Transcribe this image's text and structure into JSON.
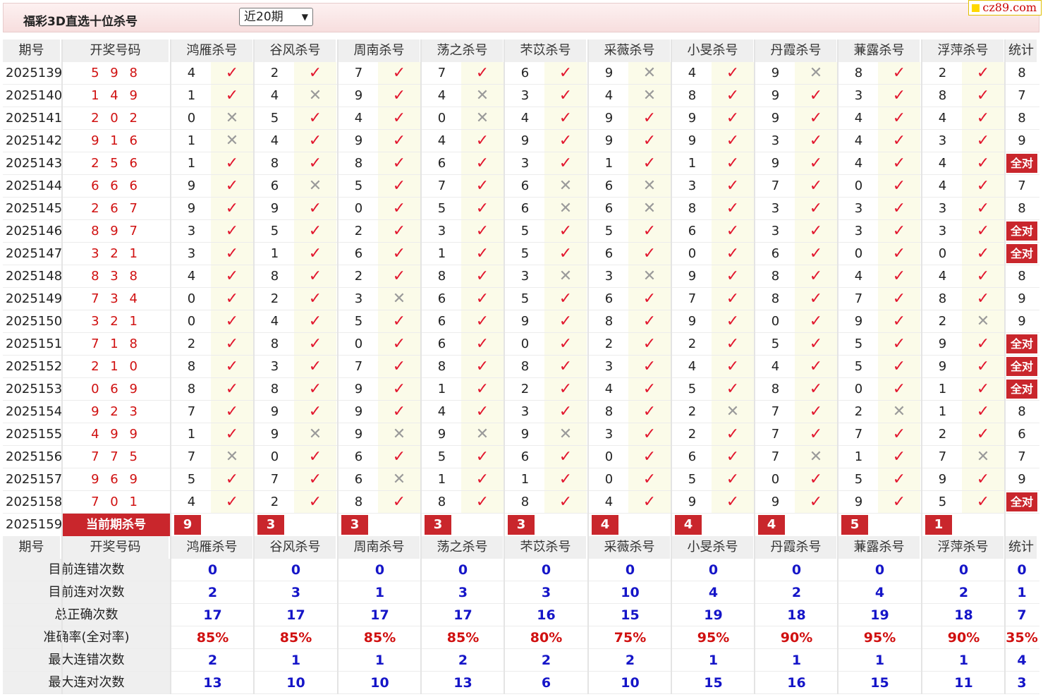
{
  "header": {
    "title": "福彩3D直选十位杀号",
    "period_select": "近20期",
    "logo": "cz89.com"
  },
  "columns": {
    "issue": "期号",
    "draw": "开奖号码",
    "experts": [
      "鸿雁杀号",
      "谷风杀号",
      "周南杀号",
      "荡之杀号",
      "芣苡杀号",
      "采薇杀号",
      "小旻杀号",
      "丹霞杀号",
      "蒹露杀号",
      "浮萍杀号"
    ],
    "stat": "统计"
  },
  "rows": [
    {
      "issue": "2025139",
      "draw": "5 9 8",
      "kills": [
        [
          4,
          1
        ],
        [
          2,
          1
        ],
        [
          7,
          1
        ],
        [
          7,
          1
        ],
        [
          6,
          1
        ],
        [
          9,
          0
        ],
        [
          4,
          1
        ],
        [
          9,
          0
        ],
        [
          8,
          1
        ],
        [
          2,
          1
        ]
      ],
      "stat": "8"
    },
    {
      "issue": "2025140",
      "draw": "1 4 9",
      "kills": [
        [
          1,
          1
        ],
        [
          4,
          0
        ],
        [
          9,
          1
        ],
        [
          4,
          0
        ],
        [
          3,
          1
        ],
        [
          4,
          0
        ],
        [
          8,
          1
        ],
        [
          9,
          1
        ],
        [
          3,
          1
        ],
        [
          8,
          1
        ]
      ],
      "stat": "7"
    },
    {
      "issue": "2025141",
      "draw": "2 0 2",
      "kills": [
        [
          0,
          0
        ],
        [
          5,
          1
        ],
        [
          4,
          1
        ],
        [
          0,
          0
        ],
        [
          4,
          1
        ],
        [
          9,
          1
        ],
        [
          9,
          1
        ],
        [
          9,
          1
        ],
        [
          4,
          1
        ],
        [
          4,
          1
        ]
      ],
      "stat": "8"
    },
    {
      "issue": "2025142",
      "draw": "9 1 6",
      "kills": [
        [
          1,
          0
        ],
        [
          4,
          1
        ],
        [
          9,
          1
        ],
        [
          4,
          1
        ],
        [
          9,
          1
        ],
        [
          9,
          1
        ],
        [
          9,
          1
        ],
        [
          3,
          1
        ],
        [
          4,
          1
        ],
        [
          3,
          1
        ]
      ],
      "stat": "9"
    },
    {
      "issue": "2025143",
      "draw": "2 5 6",
      "kills": [
        [
          1,
          1
        ],
        [
          8,
          1
        ],
        [
          8,
          1
        ],
        [
          6,
          1
        ],
        [
          3,
          1
        ],
        [
          1,
          1
        ],
        [
          1,
          1
        ],
        [
          9,
          1
        ],
        [
          4,
          1
        ],
        [
          4,
          1
        ]
      ],
      "stat": "全对"
    },
    {
      "issue": "2025144",
      "draw": "6 6 6",
      "kills": [
        [
          9,
          1
        ],
        [
          6,
          0
        ],
        [
          5,
          1
        ],
        [
          7,
          1
        ],
        [
          6,
          0
        ],
        [
          6,
          0
        ],
        [
          3,
          1
        ],
        [
          7,
          1
        ],
        [
          0,
          1
        ],
        [
          4,
          1
        ]
      ],
      "stat": "7"
    },
    {
      "issue": "2025145",
      "draw": "2 6 7",
      "kills": [
        [
          9,
          1
        ],
        [
          9,
          1
        ],
        [
          0,
          1
        ],
        [
          5,
          1
        ],
        [
          6,
          0
        ],
        [
          6,
          0
        ],
        [
          8,
          1
        ],
        [
          3,
          1
        ],
        [
          3,
          1
        ],
        [
          3,
          1
        ]
      ],
      "stat": "8"
    },
    {
      "issue": "2025146",
      "draw": "8 9 7",
      "kills": [
        [
          3,
          1
        ],
        [
          5,
          1
        ],
        [
          2,
          1
        ],
        [
          3,
          1
        ],
        [
          5,
          1
        ],
        [
          5,
          1
        ],
        [
          6,
          1
        ],
        [
          3,
          1
        ],
        [
          3,
          1
        ],
        [
          3,
          1
        ]
      ],
      "stat": "全对"
    },
    {
      "issue": "2025147",
      "draw": "3 2 1",
      "kills": [
        [
          3,
          1
        ],
        [
          1,
          1
        ],
        [
          6,
          1
        ],
        [
          1,
          1
        ],
        [
          5,
          1
        ],
        [
          6,
          1
        ],
        [
          0,
          1
        ],
        [
          6,
          1
        ],
        [
          0,
          1
        ],
        [
          0,
          1
        ]
      ],
      "stat": "全对"
    },
    {
      "issue": "2025148",
      "draw": "8 3 8",
      "kills": [
        [
          4,
          1
        ],
        [
          8,
          1
        ],
        [
          2,
          1
        ],
        [
          8,
          1
        ],
        [
          3,
          0
        ],
        [
          3,
          0
        ],
        [
          9,
          1
        ],
        [
          8,
          1
        ],
        [
          4,
          1
        ],
        [
          4,
          1
        ]
      ],
      "stat": "8"
    },
    {
      "issue": "2025149",
      "draw": "7 3 4",
      "kills": [
        [
          0,
          1
        ],
        [
          2,
          1
        ],
        [
          3,
          0
        ],
        [
          6,
          1
        ],
        [
          5,
          1
        ],
        [
          6,
          1
        ],
        [
          7,
          1
        ],
        [
          8,
          1
        ],
        [
          7,
          1
        ],
        [
          8,
          1
        ]
      ],
      "stat": "9"
    },
    {
      "issue": "2025150",
      "draw": "3 2 1",
      "kills": [
        [
          0,
          1
        ],
        [
          4,
          1
        ],
        [
          5,
          1
        ],
        [
          6,
          1
        ],
        [
          9,
          1
        ],
        [
          8,
          1
        ],
        [
          9,
          1
        ],
        [
          0,
          1
        ],
        [
          9,
          1
        ],
        [
          2,
          0
        ]
      ],
      "stat": "9"
    },
    {
      "issue": "2025151",
      "draw": "7 1 8",
      "kills": [
        [
          2,
          1
        ],
        [
          8,
          1
        ],
        [
          0,
          1
        ],
        [
          6,
          1
        ],
        [
          0,
          1
        ],
        [
          2,
          1
        ],
        [
          2,
          1
        ],
        [
          5,
          1
        ],
        [
          5,
          1
        ],
        [
          9,
          1
        ]
      ],
      "stat": "全对"
    },
    {
      "issue": "2025152",
      "draw": "2 1 0",
      "kills": [
        [
          8,
          1
        ],
        [
          3,
          1
        ],
        [
          7,
          1
        ],
        [
          8,
          1
        ],
        [
          8,
          1
        ],
        [
          3,
          1
        ],
        [
          4,
          1
        ],
        [
          4,
          1
        ],
        [
          5,
          1
        ],
        [
          9,
          1
        ]
      ],
      "stat": "全对"
    },
    {
      "issue": "2025153",
      "draw": "0 6 9",
      "kills": [
        [
          8,
          1
        ],
        [
          8,
          1
        ],
        [
          9,
          1
        ],
        [
          1,
          1
        ],
        [
          2,
          1
        ],
        [
          4,
          1
        ],
        [
          5,
          1
        ],
        [
          8,
          1
        ],
        [
          0,
          1
        ],
        [
          1,
          1
        ]
      ],
      "stat": "全对"
    },
    {
      "issue": "2025154",
      "draw": "9 2 3",
      "kills": [
        [
          7,
          1
        ],
        [
          9,
          1
        ],
        [
          9,
          1
        ],
        [
          4,
          1
        ],
        [
          3,
          1
        ],
        [
          8,
          1
        ],
        [
          2,
          0
        ],
        [
          7,
          1
        ],
        [
          2,
          0
        ],
        [
          1,
          1
        ]
      ],
      "stat": "8"
    },
    {
      "issue": "2025155",
      "draw": "4 9 9",
      "kills": [
        [
          1,
          1
        ],
        [
          9,
          0
        ],
        [
          9,
          0
        ],
        [
          9,
          0
        ],
        [
          9,
          0
        ],
        [
          3,
          1
        ],
        [
          2,
          1
        ],
        [
          7,
          1
        ],
        [
          7,
          1
        ],
        [
          2,
          1
        ]
      ],
      "stat": "6"
    },
    {
      "issue": "2025156",
      "draw": "7 7 5",
      "kills": [
        [
          7,
          0
        ],
        [
          0,
          1
        ],
        [
          6,
          1
        ],
        [
          5,
          1
        ],
        [
          6,
          1
        ],
        [
          0,
          1
        ],
        [
          6,
          1
        ],
        [
          7,
          0
        ],
        [
          1,
          1
        ],
        [
          7,
          0
        ]
      ],
      "stat": "7"
    },
    {
      "issue": "2025157",
      "draw": "9 6 9",
      "kills": [
        [
          5,
          1
        ],
        [
          7,
          1
        ],
        [
          6,
          0
        ],
        [
          1,
          1
        ],
        [
          1,
          1
        ],
        [
          0,
          1
        ],
        [
          5,
          1
        ],
        [
          0,
          1
        ],
        [
          5,
          1
        ],
        [
          9,
          1
        ]
      ],
      "stat": "9"
    },
    {
      "issue": "2025158",
      "draw": "7 0 1",
      "kills": [
        [
          4,
          1
        ],
        [
          2,
          1
        ],
        [
          8,
          1
        ],
        [
          8,
          1
        ],
        [
          8,
          1
        ],
        [
          4,
          1
        ],
        [
          9,
          1
        ],
        [
          9,
          1
        ],
        [
          9,
          1
        ],
        [
          5,
          1
        ]
      ],
      "stat": "全对"
    }
  ],
  "current": {
    "issue": "2025159",
    "label": "当前期杀号",
    "kills": [
      "9",
      "3",
      "3",
      "3",
      "3",
      "4",
      "4",
      "4",
      "5",
      "1"
    ]
  },
  "stats": [
    {
      "label": "目前连错次数",
      "values": [
        "0",
        "0",
        "0",
        "0",
        "0",
        "0",
        "0",
        "0",
        "0",
        "0"
      ],
      "stat": "0",
      "color": "blue"
    },
    {
      "label": "目前连对次数",
      "values": [
        "2",
        "3",
        "1",
        "3",
        "3",
        "10",
        "4",
        "2",
        "4",
        "2"
      ],
      "stat": "1",
      "color": "blue"
    },
    {
      "label": "总正确次数",
      "values": [
        "17",
        "17",
        "17",
        "17",
        "16",
        "15",
        "19",
        "18",
        "19",
        "18"
      ],
      "stat": "7",
      "color": "blue"
    },
    {
      "label": "准确率(全对率)",
      "values": [
        "85%",
        "85%",
        "85%",
        "85%",
        "80%",
        "75%",
        "95%",
        "90%",
        "95%",
        "90%"
      ],
      "stat": "35%",
      "color": "red"
    },
    {
      "label": "最大连错次数",
      "values": [
        "2",
        "1",
        "1",
        "2",
        "2",
        "2",
        "1",
        "1",
        "1",
        "1"
      ],
      "stat": "4",
      "color": "blue"
    },
    {
      "label": "最大连对次数",
      "values": [
        "13",
        "10",
        "10",
        "13",
        "6",
        "10",
        "15",
        "16",
        "15",
        "11"
      ],
      "stat": "3",
      "color": "blue"
    }
  ],
  "symbols": {
    "tick": "✓",
    "cross": "✕"
  },
  "colors": {
    "accent": "#c9262c",
    "draw": "#d01010",
    "stat_blue": "#1515c8",
    "mark_bg": "#fbfbe9"
  }
}
